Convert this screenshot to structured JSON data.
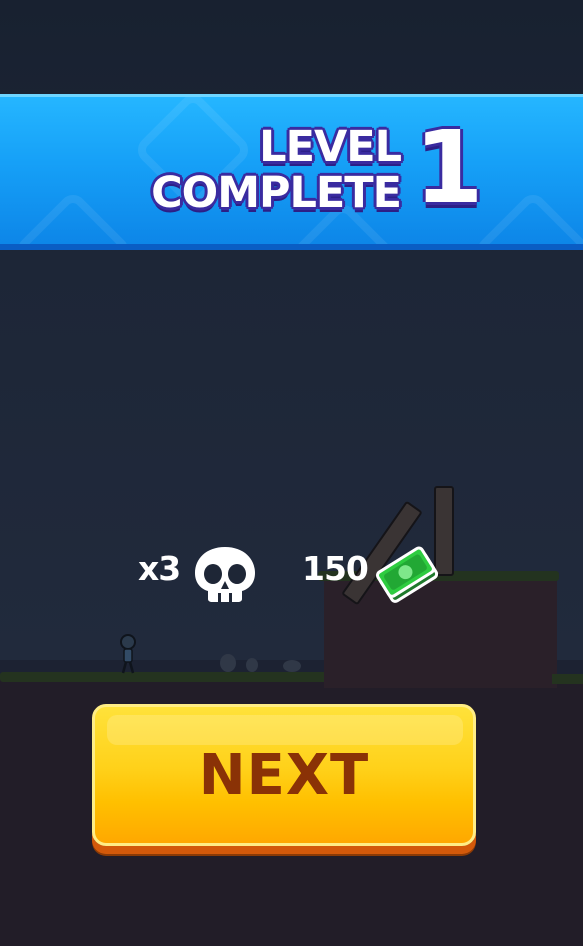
{
  "banner": {
    "title_line1": "LEVEL",
    "title_line2": "COMPLETE",
    "level_number": "1"
  },
  "rewards": {
    "kills_text": "x3",
    "kills_icon": "skull-icon",
    "cash_text": "150",
    "cash_icon": "cash-stack-icon"
  },
  "next_button": {
    "label": "NEXT"
  },
  "colors": {
    "banner_blue": "#16a0f7",
    "title_outline": "#3a2ba0",
    "button_yellow": "#ffd11a",
    "button_text": "#8a3206",
    "cash_green": "#2ecc40"
  }
}
